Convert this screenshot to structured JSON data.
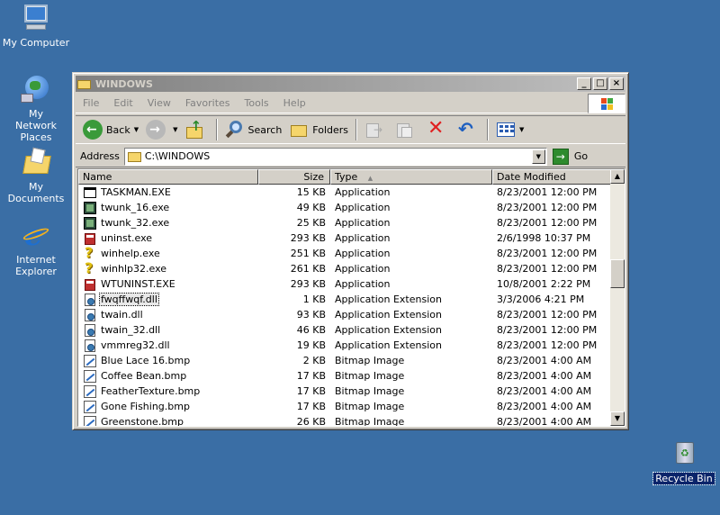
{
  "desktop": {
    "icons": [
      {
        "label": "My Computer"
      },
      {
        "label": "My Network Places"
      },
      {
        "label": "My Documents"
      },
      {
        "label": "Internet Explorer"
      },
      {
        "label": "Recycle Bin"
      }
    ]
  },
  "window": {
    "title": "WINDOWS",
    "caption_buttons": {
      "minimize": "_",
      "maximize": "□",
      "close": "×"
    },
    "menu": [
      "File",
      "Edit",
      "View",
      "Favorites",
      "Tools",
      "Help"
    ],
    "toolbar": {
      "back": "Back",
      "search": "Search",
      "folders": "Folders"
    },
    "address": {
      "label": "Address",
      "value": "C:\\WINDOWS",
      "go": "Go"
    },
    "columns": {
      "name": "Name",
      "size": "Size",
      "type": "Type",
      "date": "Date Modified",
      "sort_indicator": "▲"
    },
    "files": [
      {
        "name": "TASKMAN.EXE",
        "size": "15 KB",
        "type": "Application",
        "date": "8/23/2001 12:00 PM",
        "icon": "window-app-icon"
      },
      {
        "name": "twunk_16.exe",
        "size": "49 KB",
        "type": "Application",
        "date": "8/23/2001 12:00 PM",
        "icon": "scanner-icon"
      },
      {
        "name": "twunk_32.exe",
        "size": "25 KB",
        "type": "Application",
        "date": "8/23/2001 12:00 PM",
        "icon": "scanner-icon"
      },
      {
        "name": "uninst.exe",
        "size": "293 KB",
        "type": "Application",
        "date": "2/6/1998 10:37 PM",
        "icon": "installer-icon"
      },
      {
        "name": "winhelp.exe",
        "size": "251 KB",
        "type": "Application",
        "date": "8/23/2001 12:00 PM",
        "icon": "help-icon"
      },
      {
        "name": "winhlp32.exe",
        "size": "261 KB",
        "type": "Application",
        "date": "8/23/2001 12:00 PM",
        "icon": "help-icon"
      },
      {
        "name": "WTUNINST.EXE",
        "size": "293 KB",
        "type": "Application",
        "date": "10/8/2001 2:22 PM",
        "icon": "installer-icon"
      },
      {
        "name": "fwqffwqf.dll",
        "size": "1 KB",
        "type": "Application Extension",
        "date": "3/3/2006 4:21 PM",
        "icon": "dll-icon"
      },
      {
        "name": "twain.dll",
        "size": "93 KB",
        "type": "Application Extension",
        "date": "8/23/2001 12:00 PM",
        "icon": "dll-icon"
      },
      {
        "name": "twain_32.dll",
        "size": "46 KB",
        "type": "Application Extension",
        "date": "8/23/2001 12:00 PM",
        "icon": "dll-icon"
      },
      {
        "name": "vmmreg32.dll",
        "size": "19 KB",
        "type": "Application Extension",
        "date": "8/23/2001 12:00 PM",
        "icon": "dll-icon"
      },
      {
        "name": "Blue Lace 16.bmp",
        "size": "2 KB",
        "type": "Bitmap Image",
        "date": "8/23/2001 4:00 AM",
        "icon": "bitmap-icon"
      },
      {
        "name": "Coffee Bean.bmp",
        "size": "17 KB",
        "type": "Bitmap Image",
        "date": "8/23/2001 4:00 AM",
        "icon": "bitmap-icon"
      },
      {
        "name": "FeatherTexture.bmp",
        "size": "17 KB",
        "type": "Bitmap Image",
        "date": "8/23/2001 4:00 AM",
        "icon": "bitmap-icon"
      },
      {
        "name": "Gone Fishing.bmp",
        "size": "17 KB",
        "type": "Bitmap Image",
        "date": "8/23/2001 4:00 AM",
        "icon": "bitmap-icon"
      },
      {
        "name": "Greenstone.bmp",
        "size": "26 KB",
        "type": "Bitmap Image",
        "date": "8/23/2001 4:00 AM",
        "icon": "bitmap-icon"
      }
    ]
  }
}
